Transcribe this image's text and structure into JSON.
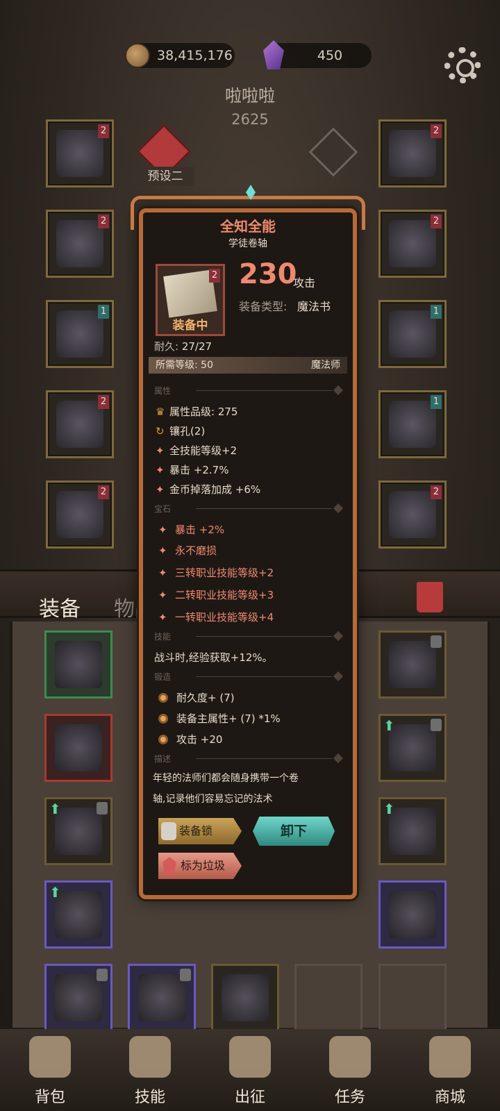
{
  "top_bar": {
    "gold": "38,415,176",
    "gems": "450",
    "icons": {
      "gold": "coin-icon",
      "gems": "gem-icon",
      "settings": "gear-icon"
    }
  },
  "player": {
    "name": "啦啦啦",
    "power": "2625",
    "preset": "预设二"
  },
  "inventory_tabs": {
    "equip": "装备",
    "items": "物品"
  },
  "tooltip": {
    "title": "全知全能",
    "subtitle": "学徒卷轴",
    "badge": "2",
    "attack_value": "230",
    "attack_label": "攻击",
    "type_label": "装备类型:",
    "type_value": "魔法书",
    "equipped": "装备中",
    "durability_label": "耐久:",
    "durability_value": "27/27",
    "required_level": "所需等级: 50",
    "required_class": "魔法师",
    "sections": {
      "attributes": "属性",
      "gems": "宝石",
      "skills": "技能",
      "forge": "锻造",
      "description": "描述"
    },
    "attributes": [
      "属性品级: 275",
      "镶孔(2)",
      "全技能等级+2",
      "暴击 +2.7%",
      "金币掉落加成 +6%"
    ],
    "gems": [
      "暴击 +2%",
      "永不磨损",
      "三转职业技能等级+2",
      "二转职业技能等级+3",
      "一转职业技能等级+4"
    ],
    "skill_text": "战斗时,经验获取+12%。",
    "forge": [
      "耐久度+ (7)",
      "装备主属性+ (7) *1%",
      "攻击 +20"
    ],
    "description_lines": [
      "年轻的法师们都会随身携带一个卷",
      "轴,记录他们容易忘记的法术"
    ],
    "buttons": {
      "lock": "装备锁",
      "unequip": "卸下",
      "trash": "标为垃圾"
    }
  },
  "bottom_nav": [
    "背包",
    "技能",
    "出征",
    "任务",
    "商城"
  ],
  "colors": {
    "accent": "#ef8a6f",
    "teal": "#6fd6c9",
    "frame": "#b56a3a"
  }
}
